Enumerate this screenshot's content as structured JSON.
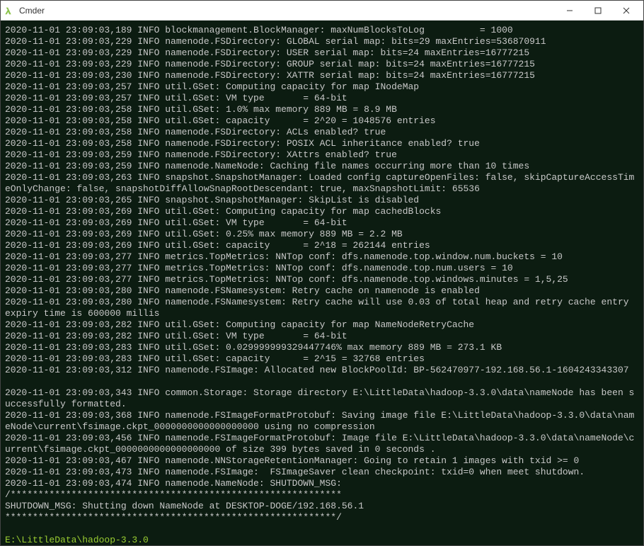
{
  "window": {
    "title": "Cmder",
    "icon": "lambda-icon"
  },
  "terminal": {
    "lines": [
      "2020-11-01 23:09:03,189 INFO blockmanagement.BlockManager: maxNumBlocksToLog          = 1000",
      "2020-11-01 23:09:03,229 INFO namenode.FSDirectory: GLOBAL serial map: bits=29 maxEntries=536870911",
      "2020-11-01 23:09:03,229 INFO namenode.FSDirectory: USER serial map: bits=24 maxEntries=16777215",
      "2020-11-01 23:09:03,229 INFO namenode.FSDirectory: GROUP serial map: bits=24 maxEntries=16777215",
      "2020-11-01 23:09:03,230 INFO namenode.FSDirectory: XATTR serial map: bits=24 maxEntries=16777215",
      "2020-11-01 23:09:03,257 INFO util.GSet: Computing capacity for map INodeMap",
      "2020-11-01 23:09:03,257 INFO util.GSet: VM type       = 64-bit",
      "2020-11-01 23:09:03,258 INFO util.GSet: 1.0% max memory 889 MB = 8.9 MB",
      "2020-11-01 23:09:03,258 INFO util.GSet: capacity      = 2^20 = 1048576 entries",
      "2020-11-01 23:09:03,258 INFO namenode.FSDirectory: ACLs enabled? true",
      "2020-11-01 23:09:03,258 INFO namenode.FSDirectory: POSIX ACL inheritance enabled? true",
      "2020-11-01 23:09:03,259 INFO namenode.FSDirectory: XAttrs enabled? true",
      "2020-11-01 23:09:03,259 INFO namenode.NameNode: Caching file names occurring more than 10 times",
      "2020-11-01 23:09:03,263 INFO snapshot.SnapshotManager: Loaded config captureOpenFiles: false, skipCaptureAccessTimeOnlyChange: false, snapshotDiffAllowSnapRootDescendant: true, maxSnapshotLimit: 65536",
      "2020-11-01 23:09:03,265 INFO snapshot.SnapshotManager: SkipList is disabled",
      "2020-11-01 23:09:03,269 INFO util.GSet: Computing capacity for map cachedBlocks",
      "2020-11-01 23:09:03,269 INFO util.GSet: VM type       = 64-bit",
      "2020-11-01 23:09:03,269 INFO util.GSet: 0.25% max memory 889 MB = 2.2 MB",
      "2020-11-01 23:09:03,269 INFO util.GSet: capacity      = 2^18 = 262144 entries",
      "2020-11-01 23:09:03,277 INFO metrics.TopMetrics: NNTop conf: dfs.namenode.top.window.num.buckets = 10",
      "2020-11-01 23:09:03,277 INFO metrics.TopMetrics: NNTop conf: dfs.namenode.top.num.users = 10",
      "2020-11-01 23:09:03,277 INFO metrics.TopMetrics: NNTop conf: dfs.namenode.top.windows.minutes = 1,5,25",
      "2020-11-01 23:09:03,280 INFO namenode.FSNamesystem: Retry cache on namenode is enabled",
      "2020-11-01 23:09:03,280 INFO namenode.FSNamesystem: Retry cache will use 0.03 of total heap and retry cache entry expiry time is 600000 millis",
      "2020-11-01 23:09:03,282 INFO util.GSet: Computing capacity for map NameNodeRetryCache",
      "2020-11-01 23:09:03,282 INFO util.GSet: VM type       = 64-bit",
      "2020-11-01 23:09:03,283 INFO util.GSet: 0.029999999329447746% max memory 889 MB = 273.1 KB",
      "2020-11-01 23:09:03,283 INFO util.GSet: capacity      = 2^15 = 32768 entries",
      "2020-11-01 23:09:03,312 INFO namenode.FSImage: Allocated new BlockPoolId: BP-562470977-192.168.56.1-1604243343307",
      "",
      "2020-11-01 23:09:03,343 INFO common.Storage: Storage directory E:\\LittleData\\hadoop-3.3.0\\data\\nameNode has been successfully formatted.",
      "2020-11-01 23:09:03,368 INFO namenode.FSImageFormatProtobuf: Saving image file E:\\LittleData\\hadoop-3.3.0\\data\\nameNode\\current\\fsimage.ckpt_0000000000000000000 using no compression",
      "2020-11-01 23:09:03,456 INFO namenode.FSImageFormatProtobuf: Image file E:\\LittleData\\hadoop-3.3.0\\data\\nameNode\\current\\fsimage.ckpt_0000000000000000000 of size 399 bytes saved in 0 seconds .",
      "2020-11-01 23:09:03,467 INFO namenode.NNStorageRetentionManager: Going to retain 1 images with txid >= 0",
      "2020-11-01 23:09:03,473 INFO namenode.FSImage:  FSImageSaver clean checkpoint: txid=0 when meet shutdown.",
      "2020-11-01 23:09:03,474 INFO namenode.NameNode: SHUTDOWN_MSG:",
      "/************************************************************",
      "SHUTDOWN_MSG: Shutting down NameNode at DESKTOP-DOGE/192.168.56.1",
      "************************************************************/",
      ""
    ],
    "prompt": "E:\\LittleData\\hadoop-3.3.0"
  }
}
